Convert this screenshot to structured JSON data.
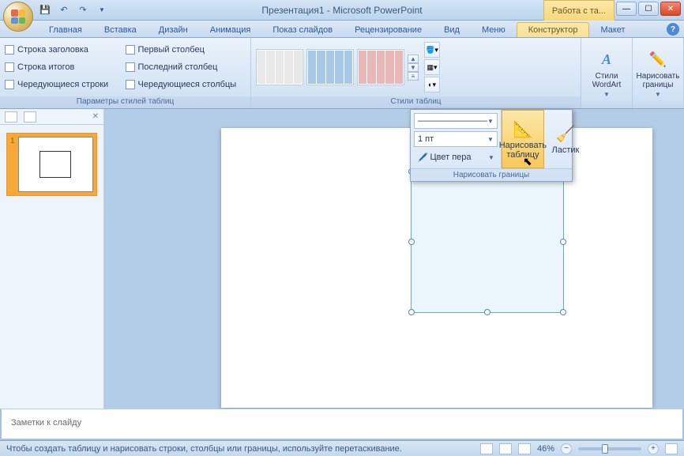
{
  "title": "Презентация1 - Microsoft PowerPoint",
  "context_tab": "Работа с та...",
  "tabs": [
    "Главная",
    "Вставка",
    "Дизайн",
    "Анимация",
    "Показ слайдов",
    "Рецензирование",
    "Вид",
    "Меню",
    "Конструктор",
    "Макет"
  ],
  "active_tab_index": 8,
  "ribbon": {
    "group1": {
      "label": "Параметры стилей таблиц",
      "opts_left": [
        "Строка заголовка",
        "Строка итогов",
        "Чередующиеся строки"
      ],
      "opts_right": [
        "Первый столбец",
        "Последний столбец",
        "Чередующиеся столбцы"
      ]
    },
    "group2": {
      "label": "Стили таблиц"
    },
    "group3": {
      "wordart": "Стили WordArt",
      "draw": "Нарисовать границы"
    }
  },
  "dropdown": {
    "line_style_sample": "————————",
    "weight": "1 пт",
    "pen_color": "Цвет пера",
    "draw_table": "Нарисовать таблицу",
    "eraser": "Ластик",
    "footer": "Нарисовать границы"
  },
  "slide_number": "1",
  "notes_placeholder": "Заметки к слайду",
  "status_text": "Чтобы создать таблицу и нарисовать строки, столбцы или границы, используйте перетаскивание.",
  "zoom": "46%"
}
